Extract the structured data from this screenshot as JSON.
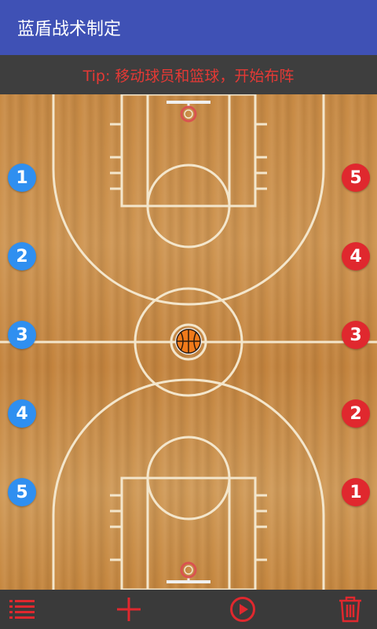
{
  "app_bar": {
    "title": "蓝盾战术制定",
    "color": "#3f51b5"
  },
  "tip": {
    "text": "Tip: 移动球员和篮球，开始布阵",
    "color": "#e53935"
  },
  "team_blue": {
    "color": "#2f8ff0",
    "players": [
      "1",
      "2",
      "3",
      "4",
      "5"
    ]
  },
  "team_red": {
    "color": "#e0282e",
    "players": [
      "5",
      "4",
      "3",
      "2",
      "1"
    ]
  },
  "ball": {
    "icon": "basketball-icon"
  },
  "bottom_bar": {
    "icons": [
      "menu-icon",
      "add-icon",
      "play-icon",
      "trash-icon"
    ],
    "icon_color": "#e0282e"
  }
}
